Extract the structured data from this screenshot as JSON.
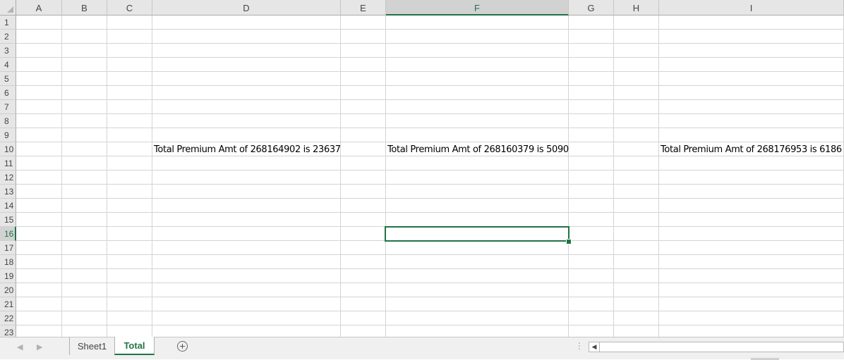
{
  "sheet": {
    "columns": [
      "A",
      "B",
      "C",
      "D",
      "E",
      "F",
      "G",
      "H",
      "I"
    ],
    "selected_column": "F",
    "rows": [
      "1",
      "2",
      "3",
      "4",
      "5",
      "6",
      "7",
      "8",
      "9",
      "10",
      "11",
      "12",
      "13",
      "14",
      "15",
      "16",
      "17",
      "18",
      "19",
      "20",
      "21",
      "22",
      "23"
    ],
    "selected_row": "16",
    "active_cell": "F16",
    "cells": {
      "D10": "Total Premium Amt of 268164902 is 23637",
      "F10": "Total Premium Amt of 268160379 is 5090",
      "I10": "Total Premium Amt of 268176953 is 6186"
    }
  },
  "tabs": {
    "items": [
      {
        "label": "Sheet1",
        "active": false
      },
      {
        "label": "Total",
        "active": true
      }
    ],
    "add_icon": "plus-circle-icon",
    "nav_prev_icon": "triangle-left-icon",
    "nav_next_icon": "triangle-right-icon"
  },
  "colors": {
    "accent": "#217346",
    "header_bg": "#e6e6e6",
    "gridline": "#d4d4d4"
  }
}
